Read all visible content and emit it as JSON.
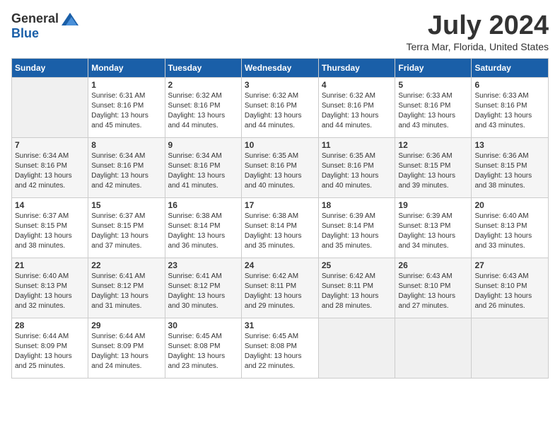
{
  "logo": {
    "general": "General",
    "blue": "Blue"
  },
  "header": {
    "title": "July 2024",
    "subtitle": "Terra Mar, Florida, United States"
  },
  "weekdays": [
    "Sunday",
    "Monday",
    "Tuesday",
    "Wednesday",
    "Thursday",
    "Friday",
    "Saturday"
  ],
  "weeks": [
    [
      {
        "num": "",
        "info": ""
      },
      {
        "num": "1",
        "info": "Sunrise: 6:31 AM\nSunset: 8:16 PM\nDaylight: 13 hours\nand 45 minutes."
      },
      {
        "num": "2",
        "info": "Sunrise: 6:32 AM\nSunset: 8:16 PM\nDaylight: 13 hours\nand 44 minutes."
      },
      {
        "num": "3",
        "info": "Sunrise: 6:32 AM\nSunset: 8:16 PM\nDaylight: 13 hours\nand 44 minutes."
      },
      {
        "num": "4",
        "info": "Sunrise: 6:32 AM\nSunset: 8:16 PM\nDaylight: 13 hours\nand 44 minutes."
      },
      {
        "num": "5",
        "info": "Sunrise: 6:33 AM\nSunset: 8:16 PM\nDaylight: 13 hours\nand 43 minutes."
      },
      {
        "num": "6",
        "info": "Sunrise: 6:33 AM\nSunset: 8:16 PM\nDaylight: 13 hours\nand 43 minutes."
      }
    ],
    [
      {
        "num": "7",
        "info": "Sunrise: 6:34 AM\nSunset: 8:16 PM\nDaylight: 13 hours\nand 42 minutes."
      },
      {
        "num": "8",
        "info": "Sunrise: 6:34 AM\nSunset: 8:16 PM\nDaylight: 13 hours\nand 42 minutes."
      },
      {
        "num": "9",
        "info": "Sunrise: 6:34 AM\nSunset: 8:16 PM\nDaylight: 13 hours\nand 41 minutes."
      },
      {
        "num": "10",
        "info": "Sunrise: 6:35 AM\nSunset: 8:16 PM\nDaylight: 13 hours\nand 40 minutes."
      },
      {
        "num": "11",
        "info": "Sunrise: 6:35 AM\nSunset: 8:16 PM\nDaylight: 13 hours\nand 40 minutes."
      },
      {
        "num": "12",
        "info": "Sunrise: 6:36 AM\nSunset: 8:15 PM\nDaylight: 13 hours\nand 39 minutes."
      },
      {
        "num": "13",
        "info": "Sunrise: 6:36 AM\nSunset: 8:15 PM\nDaylight: 13 hours\nand 38 minutes."
      }
    ],
    [
      {
        "num": "14",
        "info": "Sunrise: 6:37 AM\nSunset: 8:15 PM\nDaylight: 13 hours\nand 38 minutes."
      },
      {
        "num": "15",
        "info": "Sunrise: 6:37 AM\nSunset: 8:15 PM\nDaylight: 13 hours\nand 37 minutes."
      },
      {
        "num": "16",
        "info": "Sunrise: 6:38 AM\nSunset: 8:14 PM\nDaylight: 13 hours\nand 36 minutes."
      },
      {
        "num": "17",
        "info": "Sunrise: 6:38 AM\nSunset: 8:14 PM\nDaylight: 13 hours\nand 35 minutes."
      },
      {
        "num": "18",
        "info": "Sunrise: 6:39 AM\nSunset: 8:14 PM\nDaylight: 13 hours\nand 35 minutes."
      },
      {
        "num": "19",
        "info": "Sunrise: 6:39 AM\nSunset: 8:13 PM\nDaylight: 13 hours\nand 34 minutes."
      },
      {
        "num": "20",
        "info": "Sunrise: 6:40 AM\nSunset: 8:13 PM\nDaylight: 13 hours\nand 33 minutes."
      }
    ],
    [
      {
        "num": "21",
        "info": "Sunrise: 6:40 AM\nSunset: 8:13 PM\nDaylight: 13 hours\nand 32 minutes."
      },
      {
        "num": "22",
        "info": "Sunrise: 6:41 AM\nSunset: 8:12 PM\nDaylight: 13 hours\nand 31 minutes."
      },
      {
        "num": "23",
        "info": "Sunrise: 6:41 AM\nSunset: 8:12 PM\nDaylight: 13 hours\nand 30 minutes."
      },
      {
        "num": "24",
        "info": "Sunrise: 6:42 AM\nSunset: 8:11 PM\nDaylight: 13 hours\nand 29 minutes."
      },
      {
        "num": "25",
        "info": "Sunrise: 6:42 AM\nSunset: 8:11 PM\nDaylight: 13 hours\nand 28 minutes."
      },
      {
        "num": "26",
        "info": "Sunrise: 6:43 AM\nSunset: 8:10 PM\nDaylight: 13 hours\nand 27 minutes."
      },
      {
        "num": "27",
        "info": "Sunrise: 6:43 AM\nSunset: 8:10 PM\nDaylight: 13 hours\nand 26 minutes."
      }
    ],
    [
      {
        "num": "28",
        "info": "Sunrise: 6:44 AM\nSunset: 8:09 PM\nDaylight: 13 hours\nand 25 minutes."
      },
      {
        "num": "29",
        "info": "Sunrise: 6:44 AM\nSunset: 8:09 PM\nDaylight: 13 hours\nand 24 minutes."
      },
      {
        "num": "30",
        "info": "Sunrise: 6:45 AM\nSunset: 8:08 PM\nDaylight: 13 hours\nand 23 minutes."
      },
      {
        "num": "31",
        "info": "Sunrise: 6:45 AM\nSunset: 8:08 PM\nDaylight: 13 hours\nand 22 minutes."
      },
      {
        "num": "",
        "info": ""
      },
      {
        "num": "",
        "info": ""
      },
      {
        "num": "",
        "info": ""
      }
    ]
  ]
}
